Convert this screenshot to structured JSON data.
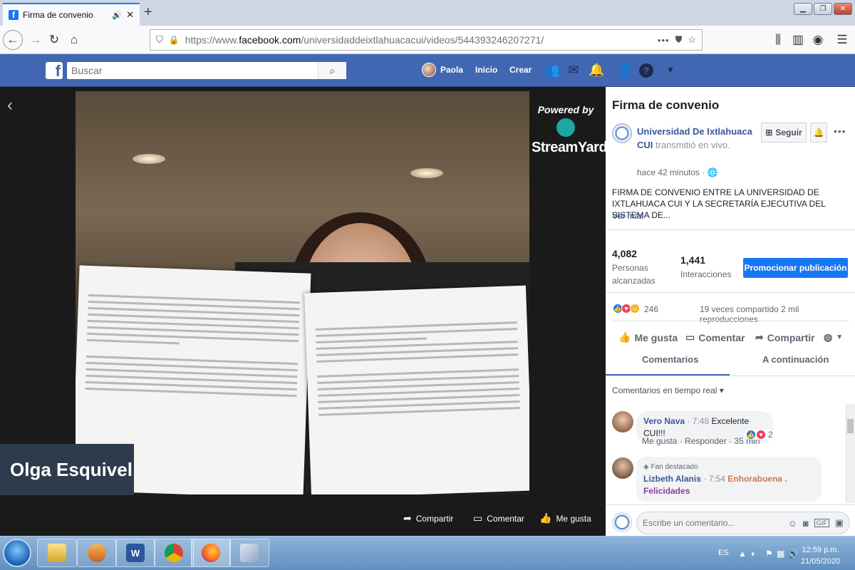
{
  "browser": {
    "tab_title": "Firma de convenio",
    "new_tab": "+",
    "url_prefix": "https://www.",
    "url_domain": "facebook.com",
    "url_path": "/universidaddeixtlahuacacui/videos/544393246207271/"
  },
  "fb_header": {
    "logo": "f",
    "search_placeholder": "Buscar",
    "user_name": "Paola",
    "nav": [
      "Inicio",
      "Crear"
    ]
  },
  "video": {
    "powered_by": "Powered by",
    "streamyard": "StreamYard",
    "speaker_name": "Olga Esquivel",
    "actions": [
      "Compartir",
      "Comentar",
      "Me gusta"
    ]
  },
  "post": {
    "title": "Firma de convenio",
    "page_name": "Universidad De Ixtlahuaca CUI",
    "transmitted": "transmitió en vivo.",
    "time": "hace 42 minutos · ",
    "follow": "Seguir",
    "description": "FIRMA DE CONVENIO ENTRE LA UNIVERSIDAD DE IXTLAHUACA CUI Y LA SECRETARÍA EJECUTIVA DEL SISTEMA DE...",
    "see_more": "Ver más",
    "stats": {
      "reached_num": "4,082",
      "reached_label": "Personas alcanzadas",
      "interactions_num": "1,441",
      "interactions_label": "Interacciones",
      "promote": "Promocionar publicación"
    },
    "reactions_count": "246",
    "shares_views": "19 veces compartido  2 mil reproducciones",
    "actions": [
      "Me gusta",
      "Comentar",
      "Compartir"
    ],
    "tabs": [
      "Comentarios",
      "A continuación"
    ],
    "comment_sort": "Comentarios en tiempo real ▾",
    "comments": [
      {
        "author": "Vero Nava",
        "time": "7:48",
        "text": "Excelente CUI!!!",
        "meta": "Me gusta · Responder · 35 min",
        "reactions": "2"
      },
      {
        "badge": "Fan destacado",
        "author": "Lizbeth Alanis",
        "time": "7:54",
        "text1": "Enhorabuena .",
        "text2": "Felicidades"
      }
    ],
    "compose_placeholder": "Escribe un comentario..."
  },
  "taskbar": {
    "lang": "ES",
    "time": "12:59 p.m.",
    "date": "21/05/2020"
  },
  "colors": {
    "fb_blue": "#4267b2",
    "button_blue": "#1877f2",
    "link": "#385898"
  }
}
